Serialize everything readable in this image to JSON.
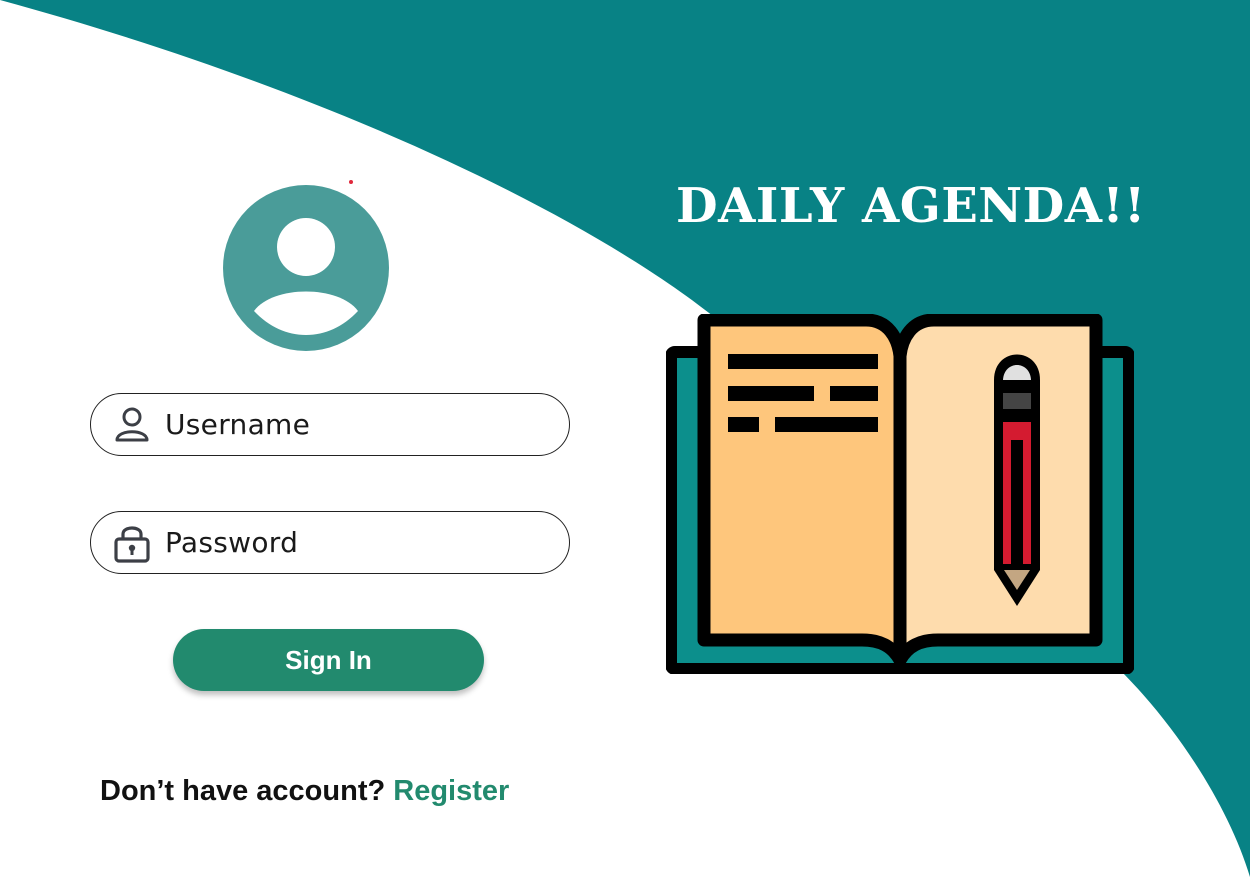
{
  "app": {
    "title": "DAILY AGENDA!!"
  },
  "login": {
    "username_placeholder": "Username",
    "password_placeholder": "Password",
    "signin_label": "Sign In",
    "no_account_text": "Don’t have account?",
    "register_label": "Register"
  },
  "icons": {
    "avatar": "user-avatar-icon",
    "username": "user-icon",
    "password": "lock-icon",
    "illustration": "open-book-pencil-icon"
  },
  "colors": {
    "teal_background": "#088285",
    "accent_green": "#228a6e",
    "avatar_teal": "#4a9c99"
  }
}
